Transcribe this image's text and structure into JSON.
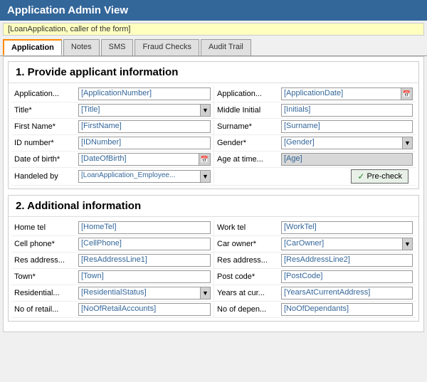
{
  "title": "Application Admin View",
  "caller_info": "[LoanApplication, caller of the form]",
  "tabs": [
    {
      "label": "Application",
      "active": true
    },
    {
      "label": "Notes",
      "active": false
    },
    {
      "label": "SMS",
      "active": false
    },
    {
      "label": "Fraud Checks",
      "active": false
    },
    {
      "label": "Audit Trail",
      "active": false
    }
  ],
  "section1": {
    "title": "1. Provide applicant information",
    "left_fields": [
      {
        "label": "Application...",
        "value": "[ApplicationNumber]",
        "type": "text"
      },
      {
        "label": "Title*",
        "value": "[Title]",
        "type": "dropdown"
      },
      {
        "label": "First Name*",
        "value": "[FirstName]",
        "type": "text"
      },
      {
        "label": "ID number*",
        "value": "[IDNumber]",
        "type": "text"
      },
      {
        "label": "Date of birth*",
        "value": "[DateOfBirth]",
        "type": "date"
      },
      {
        "label": "Handeled by",
        "value": "[LoanApplication_Employee...",
        "type": "dropdown"
      }
    ],
    "right_fields": [
      {
        "label": "Application...",
        "value": "[ApplicationDate]",
        "type": "date"
      },
      {
        "label": "Middle Initial",
        "value": "[Initials]",
        "type": "text"
      },
      {
        "label": "Surname*",
        "value": "[Surname]",
        "type": "text"
      },
      {
        "label": "Gender*",
        "value": "[Gender]",
        "type": "dropdown"
      },
      {
        "label": "Age at time...",
        "value": "[Age]",
        "type": "gray"
      },
      {
        "label": "",
        "value": "Pre-check",
        "type": "button"
      }
    ]
  },
  "section2": {
    "title": "2. Additional information",
    "left_fields": [
      {
        "label": "Home tel",
        "value": "[HomeTel]",
        "type": "text"
      },
      {
        "label": "Cell phone*",
        "value": "[CellPhone]",
        "type": "text"
      },
      {
        "label": "Res address...",
        "value": "[ResAddressLine1]",
        "type": "text"
      },
      {
        "label": "Town*",
        "value": "[Town]",
        "type": "text"
      },
      {
        "label": "Residential...",
        "value": "[ResidentialStatus]",
        "type": "dropdown"
      },
      {
        "label": "No of retail...",
        "value": "[NoOfRetailAccounts]",
        "type": "text"
      }
    ],
    "right_fields": [
      {
        "label": "Work tel",
        "value": "[WorkTel]",
        "type": "text"
      },
      {
        "label": "Car owner*",
        "value": "[CarOwner]",
        "type": "dropdown"
      },
      {
        "label": "Res address...",
        "value": "[ResAddressLine2]",
        "type": "text"
      },
      {
        "label": "Post code*",
        "value": "[PostCode]",
        "type": "text"
      },
      {
        "label": "Years at cur...",
        "value": "[YearsAtCurrentAddress]",
        "type": "text"
      },
      {
        "label": "No of depen...",
        "value": "[NoOfDependants]",
        "type": "text"
      }
    ]
  }
}
